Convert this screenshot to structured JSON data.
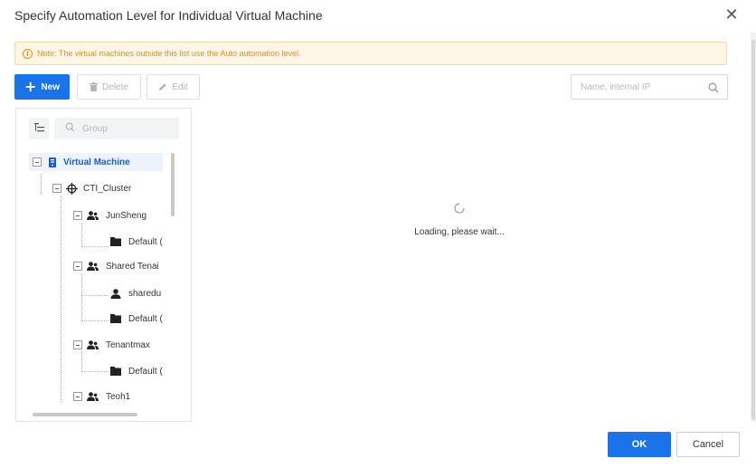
{
  "dialog": {
    "title": "Specify Automation Level for Individual Virtual Machine",
    "close_icon": "close-icon"
  },
  "notice": {
    "icon": "info-icon",
    "text": "Note: The virtual machines outside this list use the Auto automation level."
  },
  "toolbar": {
    "new_label": "New",
    "delete_label": "Delete",
    "edit_label": "Edit"
  },
  "search": {
    "placeholder": "Name, internal IP",
    "icon": "search-icon"
  },
  "tree": {
    "group_placeholder": "Group",
    "nodes": [
      {
        "label": "Virtual Machine",
        "icon": "server-icon"
      },
      {
        "label": "CTI_Cluster",
        "icon": "cluster-icon"
      },
      {
        "label": "JunSheng",
        "icon": "users-icon"
      },
      {
        "label": "Default (",
        "icon": "folder-icon"
      },
      {
        "label": "Shared Tenai",
        "icon": "users-icon"
      },
      {
        "label": "sharedu",
        "icon": "user-icon"
      },
      {
        "label": "Default (",
        "icon": "folder-icon"
      },
      {
        "label": "Tenantmax",
        "icon": "users-icon"
      },
      {
        "label": "Default (",
        "icon": "folder-icon"
      },
      {
        "label": "Teoh1",
        "icon": "users-icon"
      }
    ]
  },
  "content": {
    "loading_text": "Loading, please wait..."
  },
  "footer": {
    "ok_label": "OK",
    "cancel_label": "Cancel"
  },
  "colors": {
    "primary": "#1a73e8",
    "warning": "#e8930c",
    "notice_bg": "#fdf6e6",
    "selected_bg": "#edf2fc"
  }
}
